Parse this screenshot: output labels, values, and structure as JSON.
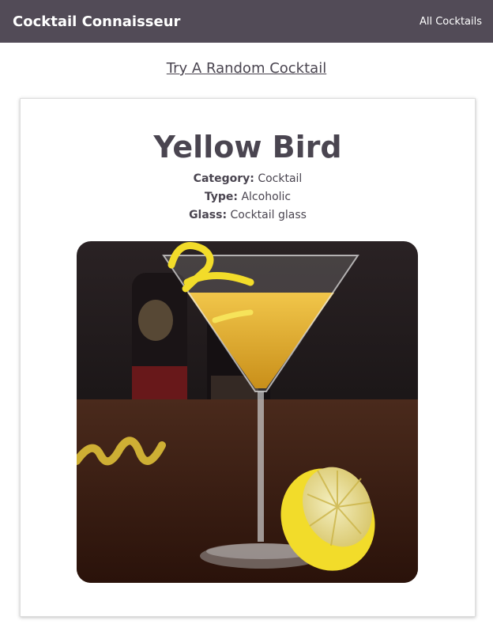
{
  "nav": {
    "brand": "Cocktail Connaisseur",
    "all_cocktails": "All Cocktails"
  },
  "random_link": "Try A Random Cocktail",
  "drink": {
    "name": "Yellow Bird",
    "category_label": "Category:",
    "category": "Cocktail",
    "type_label": "Type:",
    "type": "Alcoholic",
    "glass_label": "Glass:",
    "glass": "Cocktail glass",
    "image_alt": "Yellow Bird"
  },
  "colors": {
    "navbar": "#524b57",
    "text": "#4a4550",
    "drink": "#e0b431",
    "lemon": "#f2dc2a"
  }
}
